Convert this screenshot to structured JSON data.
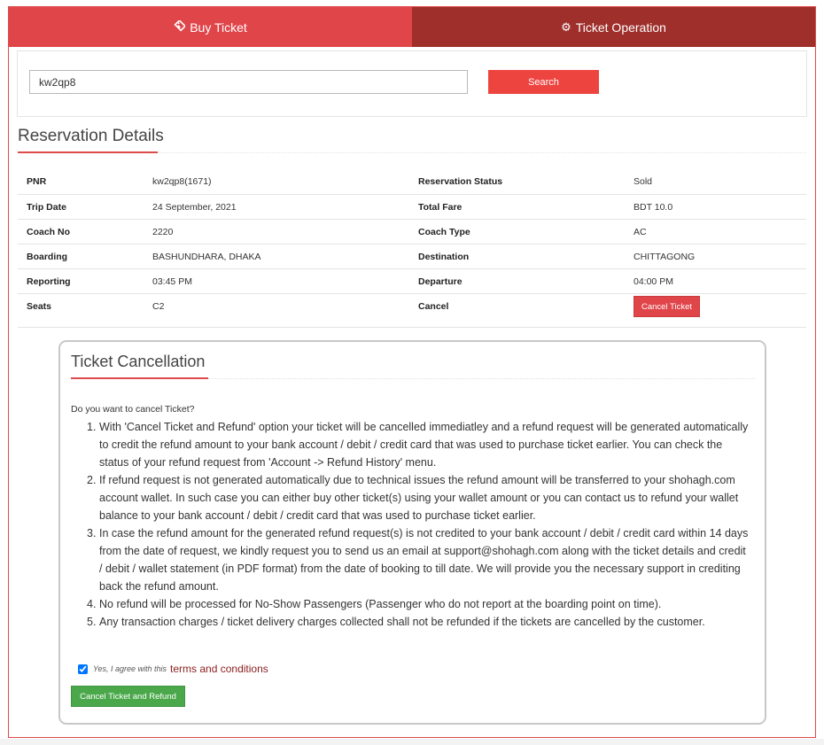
{
  "tabs": {
    "buy_label": "Buy Ticket",
    "operation_label": "Ticket Operation"
  },
  "search": {
    "value": "kw2qp8",
    "button_label": "Search"
  },
  "reservation": {
    "title": "Reservation Details",
    "rows": [
      {
        "l1": "PNR",
        "v1": "kw2qp8(1671)",
        "l2": "Reservation Status",
        "v2": "Sold"
      },
      {
        "l1": "Trip Date",
        "v1": "24 September, 2021",
        "l2": "Total Fare",
        "v2": "BDT 10.0"
      },
      {
        "l1": "Coach No",
        "v1": "2220",
        "l2": "Coach Type",
        "v2": "AC"
      },
      {
        "l1": "Boarding",
        "v1": "BASHUNDHARA, DHAKA",
        "l2": "Destination",
        "v2": "CHITTAGONG"
      },
      {
        "l1": "Reporting",
        "v1": "03:45 PM",
        "l2": "Departure",
        "v2": "04:00 PM"
      },
      {
        "l1": "Seats",
        "v1": "C2",
        "l2": "Cancel",
        "v2": ""
      }
    ],
    "cancel_button_label": "Cancel Ticket"
  },
  "cancellation": {
    "title": "Ticket Cancellation",
    "question": "Do you want to cancel Ticket?",
    "points": [
      {
        "num": "1.",
        "text": "With 'Cancel Ticket and Refund' option your ticket will be cancelled immediatley and a refund request will be generated automatically to credit the refund amount to your bank account / debit / credit card that was used to purchase ticket earlier. You can check the status of your refund request from 'Account -> Refund History' menu."
      },
      {
        "num": "2.",
        "text": "If refund request is not generated automatically due to technical issues the refund amount will be transferred to your  shohagh.com  account wallet. In such case you can either buy other ticket(s) using your wallet amount or you can contact us to refund your wallet balance to your bank account / debit / credit card that was used to purchase ticket earlier."
      },
      {
        "num": "3.",
        "text": "In case the refund amount for the generated refund request(s) is not credited to your bank account / debit / credit card within 14 days from the date of request, we kindly request you to send us an email at  support@shohagh.com  along with the ticket details and credit / debit / wallet statement (in PDF format) from the date of booking to till date. We will provide you the necessary support in crediting back the refund amount."
      },
      {
        "num": "4.",
        "text": "No refund will be processed for No-Show Passengers (Passenger who do not report at the boarding point on time)."
      },
      {
        "num": "5.",
        "text": "Any transaction charges / ticket delivery charges collected shall not be refunded if the tickets are cancelled by the customer."
      }
    ],
    "agree_text": "Yes, I agree with this",
    "terms_link": "terms and conditions",
    "agree_checked": true,
    "submit_label": "Cancel Ticket and Refund"
  },
  "colors": {
    "tab_active": "#e0454a",
    "tab_inactive": "#9e2f2b",
    "accent": "#dd4b4b",
    "search_button": "#ee4440",
    "submit_button": "#4aa84b"
  },
  "icons": {
    "buy_tab": "ticket-icon",
    "operation_tab": "gear-icon"
  }
}
